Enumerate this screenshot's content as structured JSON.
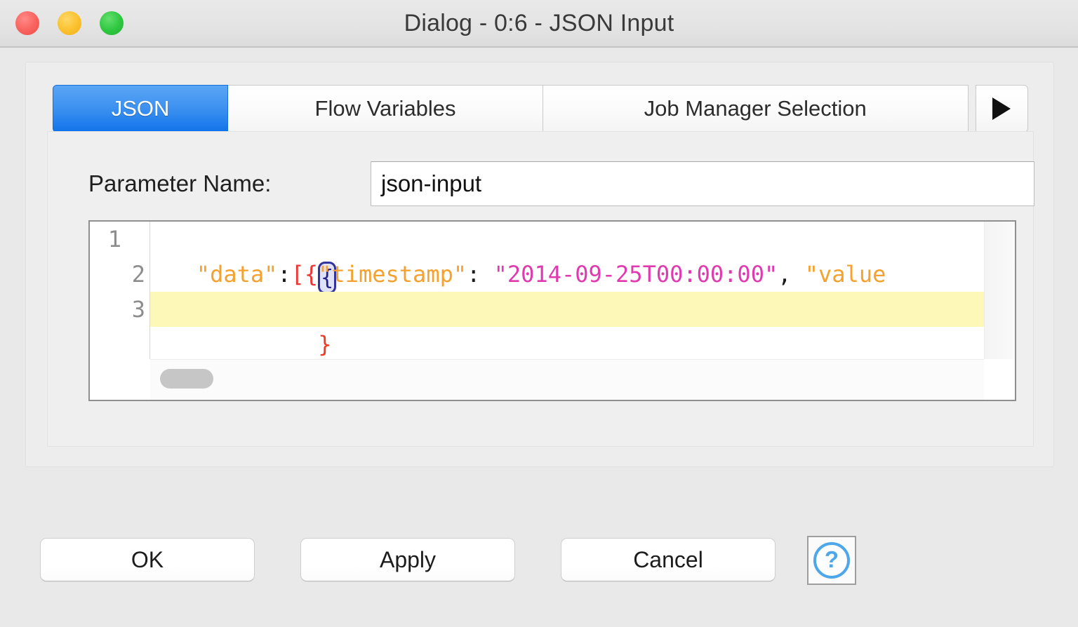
{
  "window": {
    "title": "Dialog - 0:6 - JSON Input",
    "controls": {
      "close": "close-button",
      "minimize": "minimize-button",
      "maximize": "maximize-button"
    }
  },
  "tabs": [
    {
      "label": "JSON",
      "active": true
    },
    {
      "label": "Flow Variables",
      "active": false
    },
    {
      "label": "Job Manager Selection",
      "active": false
    }
  ],
  "tab_overflow": {
    "icon": "arrow-right-icon",
    "label": "▶"
  },
  "form": {
    "parameter_name_label": "Parameter Name:",
    "parameter_name_value": "json-input",
    "parameter_name_placeholder": ""
  },
  "editor": {
    "line_numbers": [
      "1",
      "2",
      "3"
    ],
    "fold_marker": "collapse-fold-icon",
    "lines": [
      {
        "number": "1",
        "tokens": [
          {
            "type": "brace-selected",
            "text": "{"
          }
        ],
        "current": false
      },
      {
        "number": "2",
        "tokens": [
          {
            "type": "plain",
            "text": "   "
          },
          {
            "type": "key",
            "text": "\"data\""
          },
          {
            "type": "punct",
            "text": ":"
          },
          {
            "type": "brk",
            "text": "[{"
          },
          {
            "type": "key",
            "text": "\"timestamp\""
          },
          {
            "type": "punct",
            "text": ": "
          },
          {
            "type": "str",
            "text": "\"2014-09-25T00:00:00\""
          },
          {
            "type": "punct",
            "text": ", "
          },
          {
            "type": "key",
            "text": "\"value"
          }
        ],
        "current": false
      },
      {
        "number": "3",
        "tokens": [
          {
            "type": "close",
            "text": "}"
          }
        ],
        "current": true
      }
    ],
    "full_text": "{\n   \"data\":[{\"timestamp\": \"2014-09-25T00:00:00\", \"value",
    "scroll": {
      "horizontal_thumb_position": "left",
      "vertical_thumb": "none"
    }
  },
  "buttons": {
    "ok": "OK",
    "apply": "Apply",
    "cancel": "Cancel",
    "help": "?"
  },
  "colors": {
    "accent_blue": "#1173e9",
    "help_blue": "#4ea7e8",
    "dialog_bg": "#e9e9e9",
    "panel_bg": "#efefef",
    "current_line": "#fdf8b8",
    "token_key": "#f5a12f",
    "token_string": "#e03ab0",
    "token_bracket": "#ef3535",
    "token_close_brace": "#ee3b22",
    "bracket_match_border": "#33339e",
    "traffic_red": "#f9615c",
    "traffic_yellow": "#fbc02d",
    "traffic_green": "#2ec63f"
  }
}
